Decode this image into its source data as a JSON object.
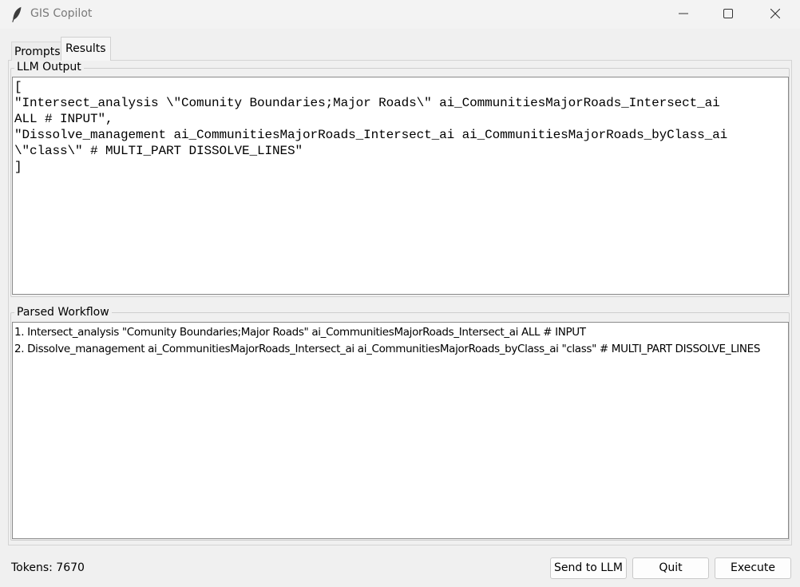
{
  "window": {
    "title": "GIS Copilot",
    "icon": "feather-icon"
  },
  "tabs": [
    {
      "label": "Prompts",
      "active": false
    },
    {
      "label": "Results",
      "active": true
    }
  ],
  "llm_output": {
    "label": "LLM Output",
    "lines": [
      "[",
      "\"Intersect_analysis \\\"Comunity Boundaries;Major Roads\\\" ai_CommunitiesMajorRoads_Intersect_ai",
      "ALL # INPUT\",",
      "\"Dissolve_management ai_CommunitiesMajorRoads_Intersect_ai ai_CommunitiesMajorRoads_byClass_ai",
      "\\\"class\\\" # MULTI_PART DISSOLVE_LINES\"",
      "]"
    ]
  },
  "parsed_workflow": {
    "label": "Parsed Workflow",
    "steps": [
      "1. Intersect_analysis \"Comunity Boundaries;Major Roads\" ai_CommunitiesMajorRoads_Intersect_ai ALL # INPUT",
      "2. Dissolve_management ai_CommunitiesMajorRoads_Intersect_ai ai_CommunitiesMajorRoads_byClass_ai \"class\" # MULTI_PART DISSOLVE_LINES"
    ]
  },
  "status": {
    "tokens": "Tokens: 7670"
  },
  "buttons": {
    "send": "Send to LLM",
    "quit": "Quit",
    "execute": "Execute"
  }
}
